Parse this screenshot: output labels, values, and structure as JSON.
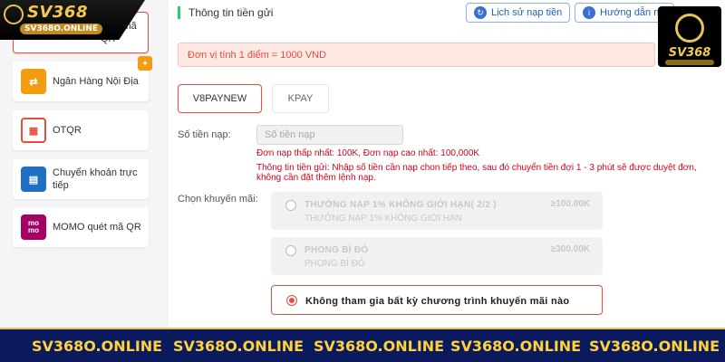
{
  "brand": {
    "name": "SV368",
    "domain": "SV368O.ONLINE"
  },
  "payment_methods": [
    {
      "label": "quét mã QR",
      "icon": "qr-scan-icon",
      "active": true
    },
    {
      "label": "Ngân Hàng Nội Địa",
      "icon": "bank-transfer-icon",
      "badge_icon": "gift-icon"
    },
    {
      "label": "OTQR",
      "icon": "qr-code-icon"
    },
    {
      "label": "Chuyển khoản trực tiếp",
      "icon": "bank-card-icon"
    },
    {
      "label": "MOMO quét mã QR",
      "icon": "momo-icon",
      "icon_text": "mo\nmo"
    }
  ],
  "header": {
    "section_title": "Thông tin tiền gửi",
    "history_button": "Lịch sử nạp tiền",
    "guide_button": "Hướng dẫn na"
  },
  "notice": "Đơn vị tính 1 điểm = 1000 VND",
  "tabs": [
    {
      "label": "V8PAYNEW",
      "active": true
    },
    {
      "label": "KPAY",
      "active": false
    }
  ],
  "amount": {
    "label": "Số tiền nạp:",
    "placeholder": "Số tiền nạp",
    "min_text": "Đơn nạp thấp nhất: 100K,  Đơn nạp cao nhất: 100,000K",
    "info_text": "Thông tin tiền gửi:    Nhập số tiền cần nạp chon tiếp theo, sau đó chuyển tiền đợi 1 - 3 phút sẽ được duyệt đơn, không cần đặt thêm lệnh nạp."
  },
  "promotions": {
    "label": "Chọn khuyến mãi:",
    "items": [
      {
        "title": "THƯỞNG NẠP 1% KHÔNG GIỚI HẠN( 2/2 )",
        "subtitle": "THƯỞNG NẠP 1% KHÔNG GIỚI HẠN",
        "amount": "≥100.00K",
        "disabled": true
      },
      {
        "title": "PHONG BÌ ĐỎ",
        "subtitle": "PHONG BÌ ĐỎ",
        "amount": "≥300.00K",
        "disabled": true
      },
      {
        "title": "Không tham gia bất kỳ chương trình khuyến mãi nào",
        "selected": true
      }
    ]
  },
  "footer": {
    "repeated_domain": [
      "SV368O.ONLINE",
      "SV368O.ONLINE",
      "SV368O.ONLINE",
      "SV368O.ONLINE",
      "SV368O.ONLINE"
    ]
  },
  "colors": {
    "accent_red": "#e74c3c",
    "green_marker": "#2ecc71",
    "footer_bg": "#0b1a5c",
    "footer_text": "#ffd23a",
    "gold": "#e8c25a"
  }
}
